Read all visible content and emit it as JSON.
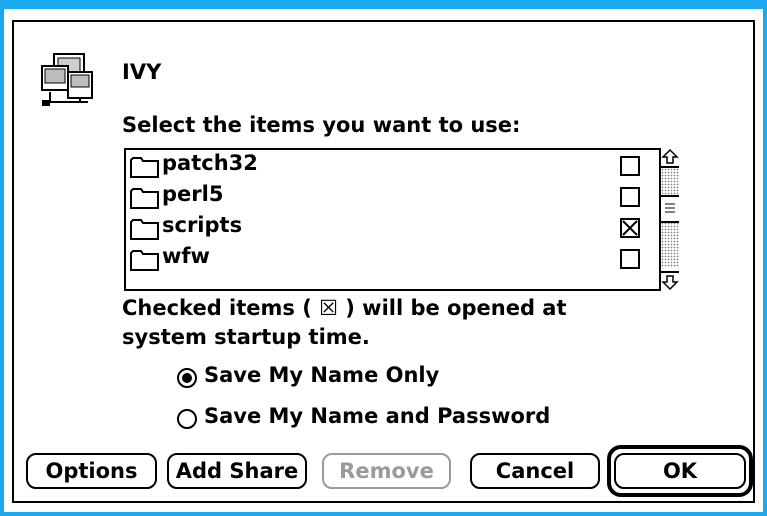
{
  "dialog": {
    "title": "IVY",
    "prompt": "Select the items you want to use:",
    "note_line1": "Checked items ( ☒ ) will be opened at",
    "note_line2": "system startup time."
  },
  "list": {
    "items": [
      {
        "label": "patch32",
        "checked": false
      },
      {
        "label": "perl5",
        "checked": false
      },
      {
        "label": "scripts",
        "checked": true
      },
      {
        "label": "wfw",
        "checked": false
      }
    ]
  },
  "options": {
    "save_name_only": "Save My Name Only",
    "save_name_password": "Save My Name and Password",
    "selected": "save_name_only"
  },
  "buttons": {
    "options": "Options",
    "add_share": "Add Share",
    "remove": "Remove",
    "cancel": "Cancel",
    "ok": "OK"
  },
  "colors": {
    "title_bar": "#1aa8f0",
    "disabled": "#9a9a9a"
  },
  "icons": {
    "app": "computer-network-icon",
    "folder": "folder-icon",
    "scroll_up": "arrow-up-icon",
    "scroll_down": "arrow-down-icon"
  }
}
